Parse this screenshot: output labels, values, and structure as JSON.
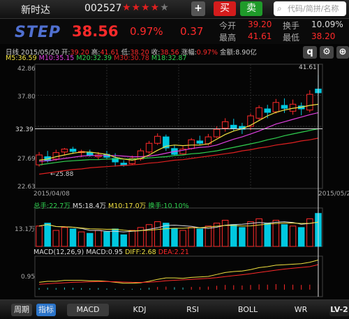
{
  "header": {
    "stock_name": "新时达",
    "stock_code": "002527",
    "stars_on": "★★★★",
    "stars_off": "★",
    "add_label": "+",
    "buy_label": "买",
    "sell_label": "卖",
    "search_placeholder": "代码/简拼/名称"
  },
  "quote": {
    "logo": "STEP",
    "price": "38.56",
    "change_pct": "0.97%",
    "change": "0.37",
    "open_label": "今开",
    "open": "39.20",
    "turnover_label": "换手",
    "turnover": "10.09%",
    "high_label": "最高",
    "high": "41.61",
    "low_label": "最低",
    "low": "38.20"
  },
  "chart_info": {
    "period_label": "日线",
    "date": "2015/05/20",
    "open_label": "开:",
    "open": "39.20",
    "high_label": "高:",
    "high": "41.61",
    "low_label": "低:",
    "low": "38.20",
    "close_label": "收:",
    "close": "38.56",
    "chg_label": "涨幅:",
    "chg": "0.97%",
    "amount_label": "金额:",
    "amount": "8.90亿",
    "ma5": "M5:36.59",
    "ma10": "M10:35.15",
    "ma20": "M20:32.39",
    "ma30": "M30:30.78",
    "ma18": "M18:32.87"
  },
  "toolbar": {
    "q_label": "q",
    "settings_icon": "gear-icon",
    "zoom_icon": "zoom-in-icon"
  },
  "price_chart": {
    "y_labels": [
      "42.86",
      "37.80",
      "32.39",
      "27.69",
      "22.63"
    ],
    "highest_label": "41.61",
    "lowest_label": "←25.88",
    "start_date": "2015/04/08",
    "end_date": "2015/05/20"
  },
  "volume": {
    "total": "总手:22.7万",
    "m5": "M5:18.4万",
    "m10": "M10:17.0万",
    "turnover": "换手:10.10%",
    "axis_label": "13.1万"
  },
  "macd": {
    "title": "MACD(12,26,9)",
    "macd": "MACD:0.95",
    "diff": "DIFF:2.68",
    "dea": "DEA:2.21",
    "axis_label": "0.95"
  },
  "bottom": {
    "period": "周期",
    "indicator": "指标",
    "tabs": [
      "MACD",
      "KDJ",
      "RSI",
      "BOLL",
      "WR"
    ],
    "level": "LV-2"
  },
  "colors": {
    "up": "#ff2a2a",
    "down": "#00c8e0",
    "ma5": "#f0e040",
    "ma10": "#e040e0",
    "ma20": "#30d050",
    "ma30": "#e02020"
  },
  "chart_data": {
    "type": "candlestick",
    "x_start": "2015/04/08",
    "x_end": "2015/05/20",
    "ylim": [
      22.63,
      42.86
    ],
    "candles": [
      {
        "o": 26.2,
        "c": 27.9,
        "h": 28.4,
        "l": 25.9
      },
      {
        "o": 27.6,
        "c": 26.9,
        "h": 28.6,
        "l": 26.6
      },
      {
        "o": 27.2,
        "c": 28.3,
        "h": 28.8,
        "l": 26.9
      },
      {
        "o": 28.4,
        "c": 28.9,
        "h": 29.1,
        "l": 27.8
      },
      {
        "o": 28.9,
        "c": 28.5,
        "h": 29.3,
        "l": 28.1
      },
      {
        "o": 28.3,
        "c": 28.5,
        "h": 28.8,
        "l": 27.5
      },
      {
        "o": 28.3,
        "c": 27.8,
        "h": 28.8,
        "l": 27.6
      },
      {
        "o": 27.6,
        "c": 27.9,
        "h": 28.4,
        "l": 27.1
      },
      {
        "o": 28.0,
        "c": 27.5,
        "h": 28.6,
        "l": 27.2
      },
      {
        "o": 27.3,
        "c": 26.7,
        "h": 28.2,
        "l": 25.9
      },
      {
        "o": 26.5,
        "c": 26.1,
        "h": 27.0,
        "l": 25.9
      },
      {
        "o": 26.4,
        "c": 27.3,
        "h": 27.8,
        "l": 26.2
      },
      {
        "o": 27.2,
        "c": 28.6,
        "h": 29.0,
        "l": 26.9
      },
      {
        "o": 28.4,
        "c": 29.9,
        "h": 30.3,
        "l": 28.1
      },
      {
        "o": 29.9,
        "c": 31.1,
        "h": 31.6,
        "l": 29.6
      },
      {
        "o": 31.0,
        "c": 29.1,
        "h": 31.4,
        "l": 28.6
      },
      {
        "o": 29.0,
        "c": 28.0,
        "h": 29.6,
        "l": 27.8
      },
      {
        "o": 28.1,
        "c": 28.9,
        "h": 29.4,
        "l": 27.9
      },
      {
        "o": 29.0,
        "c": 30.5,
        "h": 30.8,
        "l": 28.8
      },
      {
        "o": 30.3,
        "c": 29.9,
        "h": 31.2,
        "l": 29.6
      },
      {
        "o": 29.8,
        "c": 31.0,
        "h": 31.5,
        "l": 29.5
      },
      {
        "o": 31.0,
        "c": 32.3,
        "h": 32.8,
        "l": 30.8
      },
      {
        "o": 32.5,
        "c": 33.6,
        "h": 34.2,
        "l": 31.9
      },
      {
        "o": 33.0,
        "c": 32.5,
        "h": 34.1,
        "l": 32.0
      },
      {
        "o": 32.8,
        "c": 32.3,
        "h": 33.4,
        "l": 31.5
      },
      {
        "o": 32.8,
        "c": 34.6,
        "h": 35.0,
        "l": 32.1
      },
      {
        "o": 34.2,
        "c": 36.0,
        "h": 36.4,
        "l": 33.9
      },
      {
        "o": 35.8,
        "c": 35.2,
        "h": 36.5,
        "l": 34.2
      },
      {
        "o": 35.3,
        "c": 36.9,
        "h": 37.5,
        "l": 35.0
      },
      {
        "o": 36.4,
        "c": 35.9,
        "h": 37.6,
        "l": 35.1
      },
      {
        "o": 35.4,
        "c": 36.6,
        "h": 37.4,
        "l": 34.8
      },
      {
        "o": 36.3,
        "c": 35.8,
        "h": 36.9,
        "l": 34.7
      },
      {
        "o": 35.6,
        "c": 38.3,
        "h": 39.0,
        "l": 35.2
      },
      {
        "o": 39.2,
        "c": 38.56,
        "h": 41.61,
        "l": 38.2
      }
    ],
    "ma5": [
      27.0,
      27.2,
      27.6,
      27.9,
      28.2,
      28.4,
      28.4,
      28.2,
      28.0,
      27.5,
      27.2,
      27.0,
      27.3,
      27.9,
      28.7,
      29.4,
      29.6,
      29.5,
      29.6,
      29.6,
      29.8,
      30.6,
      31.4,
      32.0,
      32.4,
      33.0,
      33.8,
      34.6,
      35.2,
      35.6,
      35.9,
      36.1,
      36.4,
      36.59
    ],
    "ma10": [
      26.8,
      26.9,
      27.1,
      27.3,
      27.5,
      27.7,
      27.8,
      27.8,
      27.8,
      27.8,
      27.7,
      27.6,
      27.6,
      27.7,
      27.9,
      28.2,
      28.5,
      28.7,
      29.0,
      29.2,
      29.3,
      29.6,
      30.1,
      30.6,
      31.0,
      31.5,
      32.0,
      32.6,
      33.2,
      33.6,
      34.0,
      34.4,
      34.8,
      35.15
    ],
    "ma20": [
      26.2,
      26.4,
      26.6,
      26.8,
      26.9,
      27.0,
      27.1,
      27.1,
      27.2,
      27.2,
      27.2,
      27.2,
      27.3,
      27.4,
      27.5,
      27.6,
      27.8,
      27.9,
      28.1,
      28.2,
      28.4,
      28.6,
      28.9,
      29.2,
      29.5,
      29.8,
      30.1,
      30.5,
      30.8,
      31.2,
      31.5,
      31.8,
      32.1,
      32.39
    ],
    "ma30": [
      24.6,
      24.8,
      25.0,
      25.2,
      25.4,
      25.5,
      25.7,
      25.8,
      25.9,
      26.0,
      26.1,
      26.2,
      26.3,
      26.5,
      26.6,
      26.8,
      27.0,
      27.1,
      27.3,
      27.5,
      27.7,
      27.9,
      28.1,
      28.3,
      28.6,
      28.8,
      29.1,
      29.3,
      29.6,
      29.8,
      30.0,
      30.3,
      30.5,
      30.78
    ],
    "volume": [
      14,
      16,
      11,
      13,
      12,
      10,
      9,
      11,
      10,
      12,
      8,
      11,
      13,
      15,
      17,
      16,
      12,
      11,
      13,
      12,
      14,
      16,
      18,
      15,
      13,
      17,
      19,
      16,
      18,
      15,
      14,
      13,
      19,
      22.7
    ],
    "macd_hist": [
      0.3,
      0.35,
      0.3,
      0.4,
      0.35,
      0.3,
      0.25,
      0.3,
      0.2,
      0.15,
      0.1,
      0.15,
      0.2,
      0.35,
      0.5,
      0.55,
      0.45,
      0.4,
      0.5,
      0.5,
      0.55,
      0.7,
      0.85,
      0.8,
      0.75,
      0.85,
      0.95,
      0.9,
      1.0,
      0.95,
      0.9,
      0.85,
      0.9,
      0.95
    ],
    "diff": [
      0.4,
      0.5,
      0.5,
      0.6,
      0.6,
      0.6,
      0.55,
      0.55,
      0.5,
      0.4,
      0.3,
      0.3,
      0.35,
      0.5,
      0.7,
      0.85,
      0.85,
      0.8,
      0.9,
      0.95,
      1.0,
      1.2,
      1.4,
      1.5,
      1.55,
      1.7,
      1.9,
      2.0,
      2.15,
      2.2,
      2.25,
      2.3,
      2.45,
      2.68
    ],
    "dea": [
      0.2,
      0.25,
      0.3,
      0.35,
      0.4,
      0.42,
      0.45,
      0.47,
      0.48,
      0.46,
      0.43,
      0.4,
      0.39,
      0.41,
      0.47,
      0.55,
      0.61,
      0.65,
      0.7,
      0.75,
      0.8,
      0.88,
      0.98,
      1.08,
      1.17,
      1.28,
      1.4,
      1.52,
      1.64,
      1.75,
      1.84,
      1.92,
      2.0,
      2.21
    ]
  }
}
